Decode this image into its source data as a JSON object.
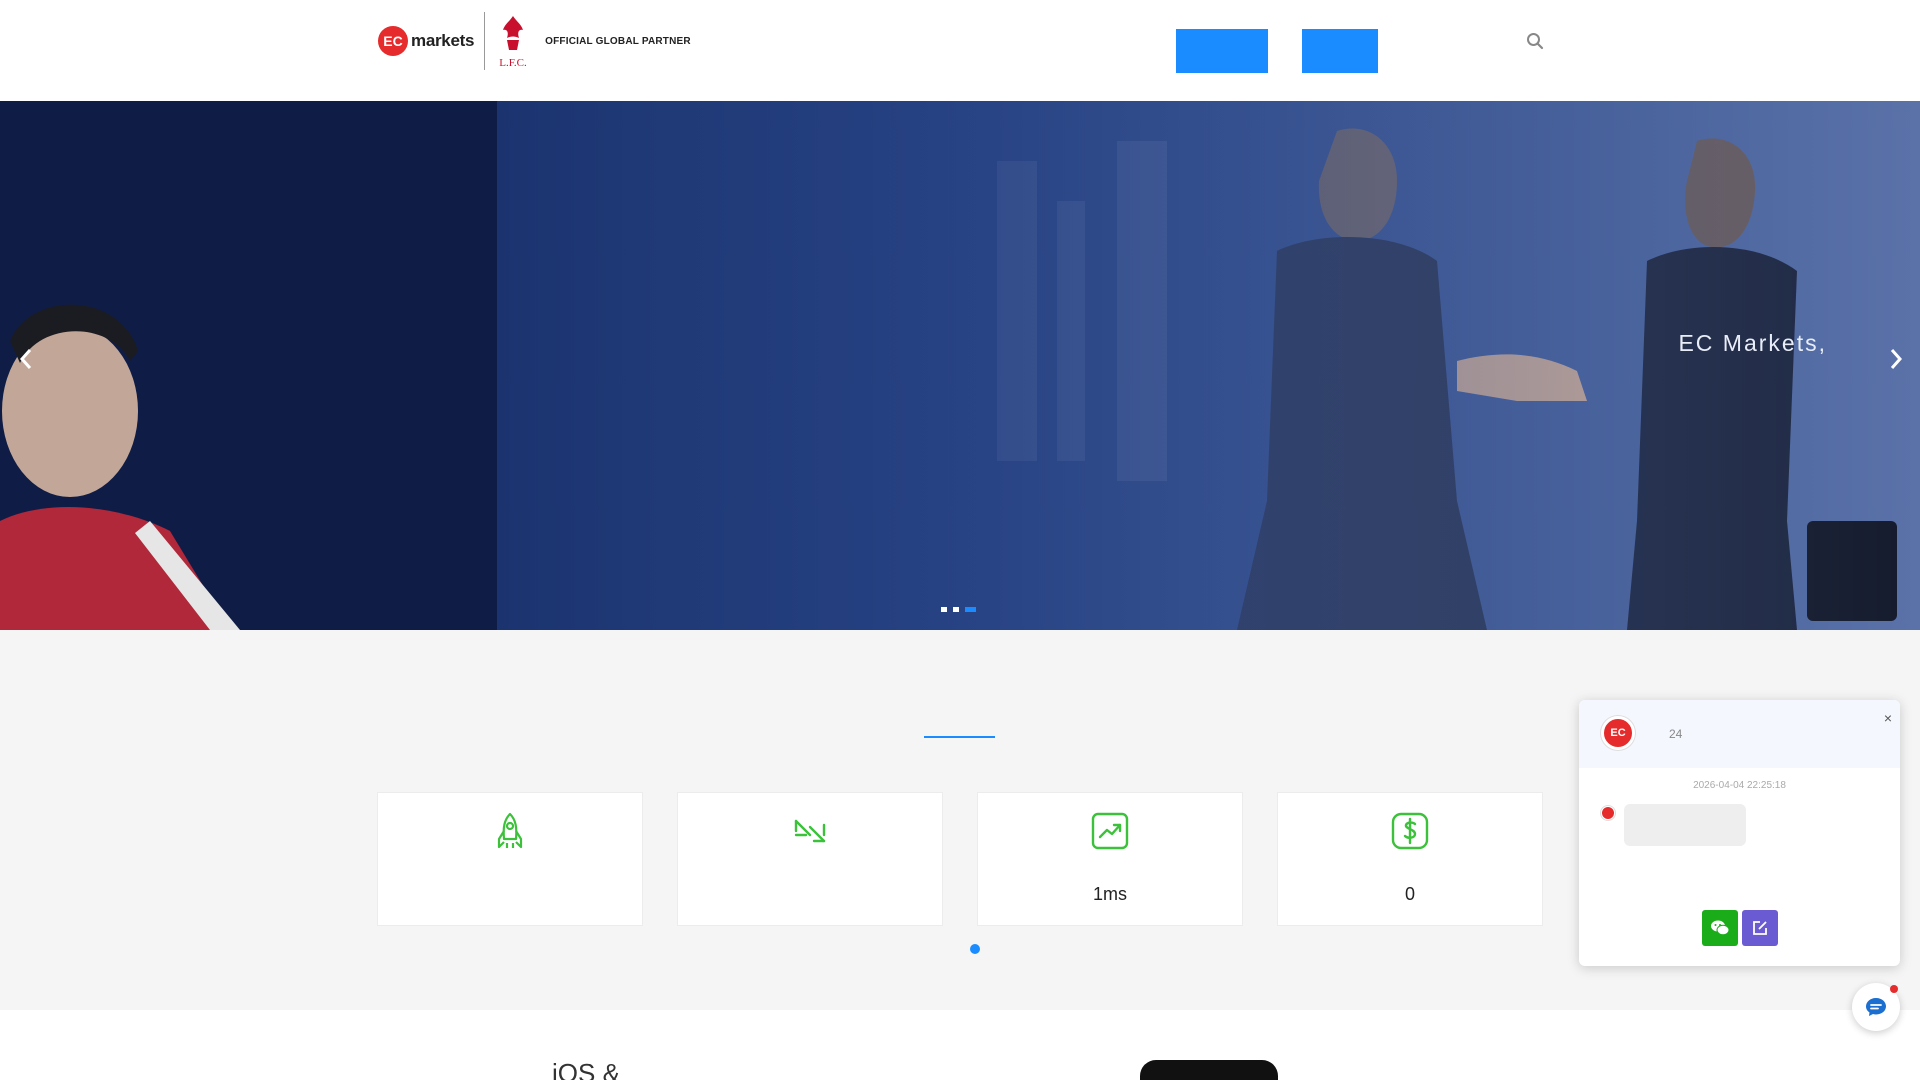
{
  "header": {
    "logo_badge": "EC",
    "logo_word": "markets",
    "partner_text": "OFFICIAL GLOBAL PARTNER",
    "nav_buttons": [
      "",
      ""
    ]
  },
  "hero": {
    "caption": "EC Markets,",
    "slides_count": 3,
    "active_slide": 3
  },
  "features": {
    "cards": [
      {
        "icon": "rocket-icon",
        "value": ""
      },
      {
        "icon": "arrows-exchange-icon",
        "value": ""
      },
      {
        "icon": "trending-up-icon",
        "value": "1ms"
      },
      {
        "icon": "dollar-icon",
        "value": "0"
      }
    ]
  },
  "download": {
    "heading": "iOS &"
  },
  "chat": {
    "avatar_label": "EC",
    "title": "24",
    "timestamp": "2026-04-04 22:25:18",
    "close_label": "×"
  },
  "colors": {
    "accent": "#1a8cff",
    "brand_red": "#e52b2b",
    "icon_green": "#3cc13b",
    "wechat_green": "#1aad19",
    "edit_purple": "#6b5bd2"
  }
}
